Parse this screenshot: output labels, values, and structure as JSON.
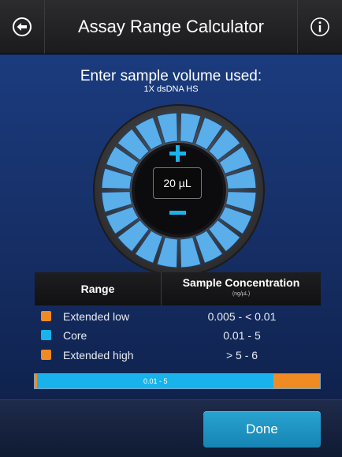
{
  "header": {
    "title": "Assay Range Calculator",
    "back_icon": "circle-arrow-left-icon",
    "info_icon": "info-circle-icon"
  },
  "prompt": {
    "text": "Enter sample volume used:",
    "assay": "1X dsDNA HS"
  },
  "dial": {
    "volume": "20 µL",
    "increment_icon": "plus-icon",
    "decrement_icon": "minus-icon"
  },
  "table": {
    "headers": {
      "range": "Range",
      "concentration": "Sample Concentration",
      "unit": "(ng/µL)"
    },
    "rows": [
      {
        "label": "Extended low",
        "value": "0.005  -  < 0.01",
        "color": "#f08b23"
      },
      {
        "label": "Core",
        "value": "0.01  -  5",
        "color": "#19b3ec"
      },
      {
        "label": "Extended high",
        "value": "> 5  -  6",
        "color": "#f08b23"
      }
    ]
  },
  "range_bar": {
    "label": "0.01 - 5",
    "core_fraction": 0.83,
    "low_color": "#f08b23",
    "core_color": "#19b3ec",
    "high_color": "#f08b23"
  },
  "footer": {
    "done_label": "Done"
  }
}
